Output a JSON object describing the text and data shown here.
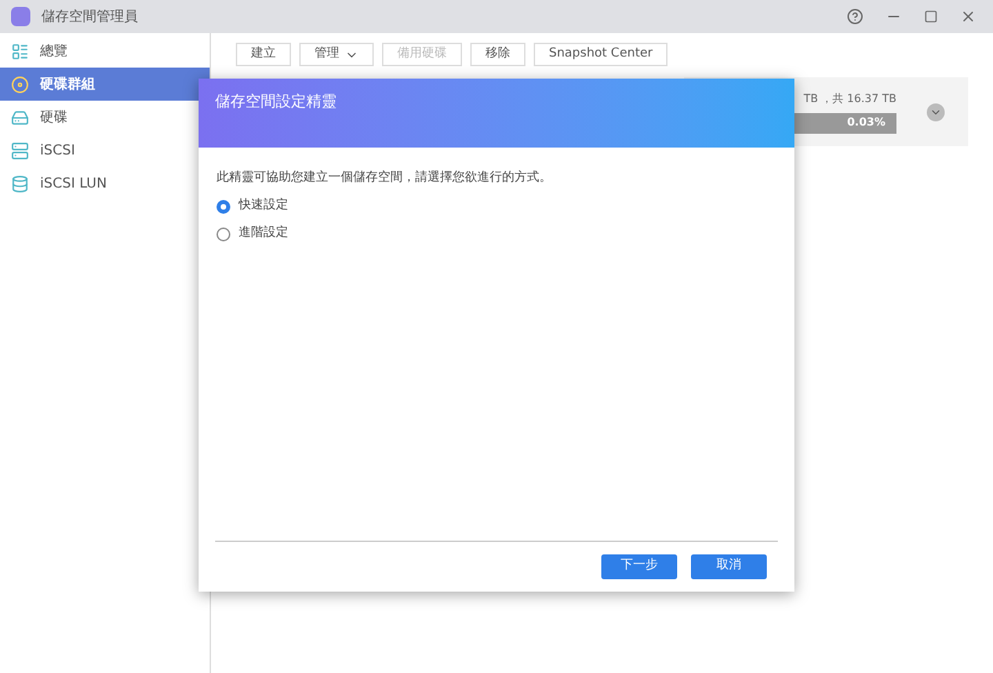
{
  "window": {
    "title": "儲存空間管理員"
  },
  "sidebar": {
    "items": [
      {
        "label": "總覽",
        "selected": false
      },
      {
        "label": "硬碟群組",
        "selected": true
      },
      {
        "label": "硬碟",
        "selected": false
      },
      {
        "label": "iSCSI",
        "selected": false
      },
      {
        "label": "iSCSI LUN",
        "selected": false
      }
    ]
  },
  "toolbar": [
    {
      "label": "建立",
      "disabled": false,
      "dropdown": false
    },
    {
      "label": "管理",
      "disabled": false,
      "dropdown": true
    },
    {
      "label": "備用硬碟",
      "disabled": true,
      "dropdown": false
    },
    {
      "label": "移除",
      "disabled": false,
      "dropdown": false
    },
    {
      "label": "Snapshot Center",
      "disabled": false,
      "dropdown": false
    }
  ],
  "volume_card": {
    "capacity": "TB ，共 16.37 TB",
    "usage": "0.03%",
    "level": 0.0003
  },
  "dialog": {
    "title": "儲存空間設定精靈",
    "description": "此精靈可協助您建立一個儲存空間，請選擇您欲進行的方式。",
    "options": [
      {
        "label": "快速設定",
        "selected": true
      },
      {
        "label": "進階設定",
        "selected": false
      }
    ],
    "buttons": [
      {
        "label": "下一步"
      },
      {
        "label": "取消"
      }
    ]
  }
}
